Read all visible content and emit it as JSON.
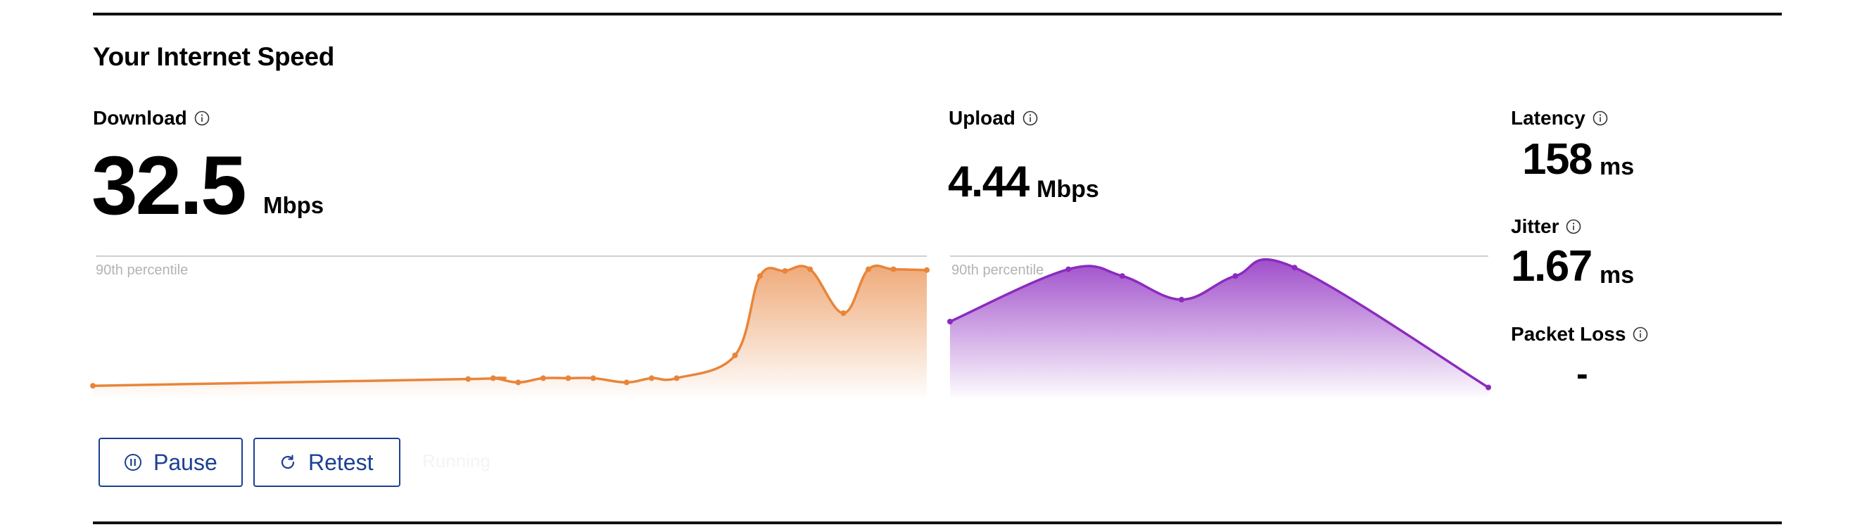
{
  "heading": "Your Internet Speed",
  "download": {
    "label": "Download",
    "value": "32.5",
    "unit": "Mbps",
    "percentile_label": "90th percentile",
    "color": "#e8853a"
  },
  "upload": {
    "label": "Upload",
    "value": "4.44",
    "unit": "Mbps",
    "percentile_label": "90th percentile",
    "color": "#8a2bbe"
  },
  "latency": {
    "label": "Latency",
    "value": "158",
    "unit": "ms"
  },
  "jitter": {
    "label": "Jitter",
    "value": "1.67",
    "unit": "ms"
  },
  "packet_loss": {
    "label": "Packet Loss",
    "value": "-"
  },
  "buttons": {
    "pause": "Pause",
    "retest": "Retest"
  },
  "status_text": "Running",
  "chart_data": [
    {
      "type": "area",
      "series": [
        {
          "values": [
            0.07,
            0.11,
            0.115,
            0.09,
            0.115,
            0.115,
            0.115,
            0.09,
            0.115,
            0.115,
            0.25,
            0.72,
            0.75,
            0.76,
            0.5,
            0.76,
            0.76,
            0.755
          ]
        }
      ],
      "x": [
        0,
        0.45,
        0.48,
        0.51,
        0.54,
        0.57,
        0.6,
        0.64,
        0.67,
        0.7,
        0.77,
        0.8,
        0.83,
        0.86,
        0.9,
        0.93,
        0.96,
        1.0
      ],
      "percentile_line": 0.76,
      "ylim": [
        0,
        1
      ]
    },
    {
      "type": "area",
      "series": [
        {
          "values": [
            0.45,
            0.76,
            0.72,
            0.58,
            0.72,
            0.77,
            0.06
          ]
        }
      ],
      "x": [
        0,
        0.22,
        0.32,
        0.43,
        0.53,
        0.64,
        1.0
      ],
      "percentile_line": 0.76,
      "ylim": [
        0,
        1
      ]
    }
  ]
}
